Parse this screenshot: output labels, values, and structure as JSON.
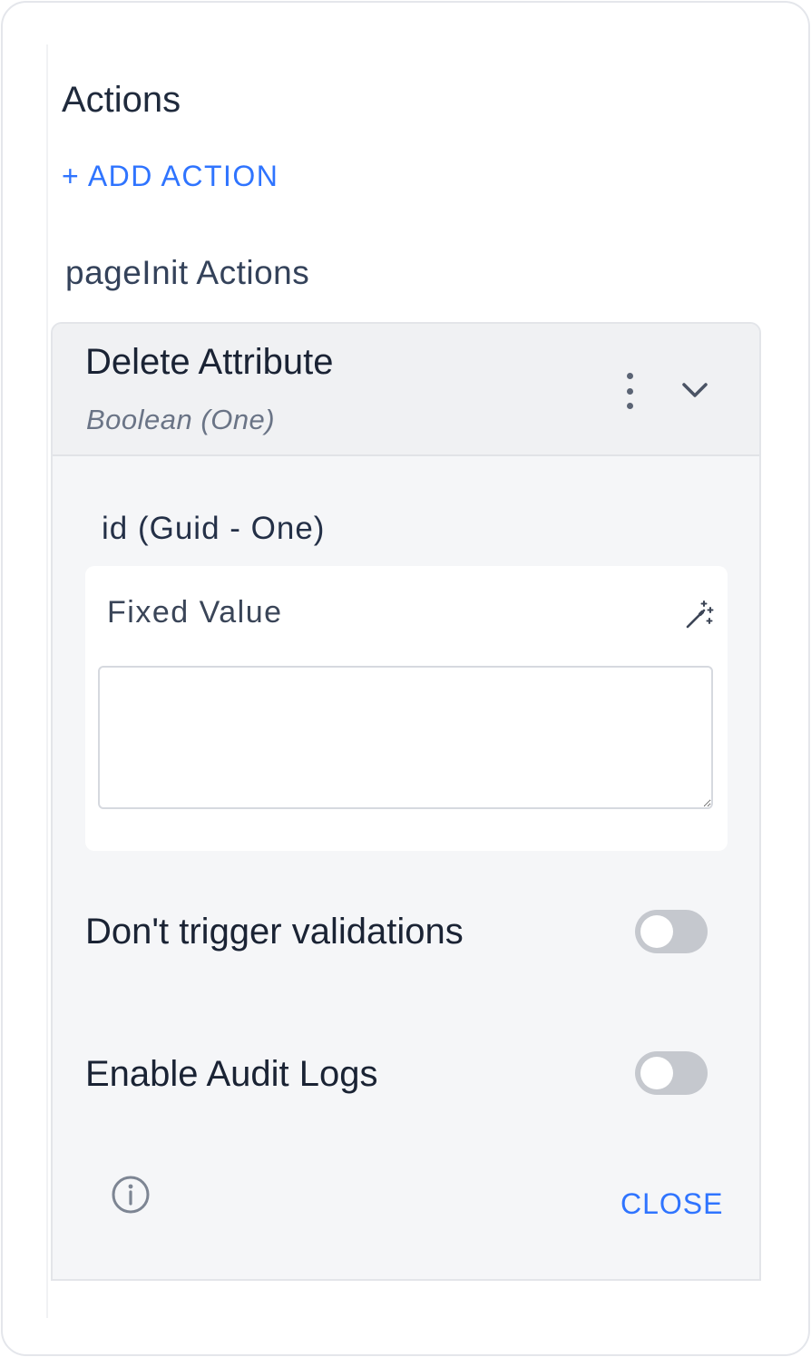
{
  "panel": {
    "title": "Actions",
    "add_action_label": "+ ADD ACTION",
    "group_title": "pageInit Actions"
  },
  "action": {
    "name": "Delete Attribute",
    "type": "Boolean (One)",
    "menu_icon": "kebab-menu-icon",
    "expand_icon": "chevron-down-icon",
    "parameter": {
      "label": "id (Guid - One)",
      "mode_label": "Fixed Value",
      "mode_icon": "magic-wand-icon",
      "value": "",
      "placeholder": ""
    },
    "toggles": [
      {
        "label": "Don't trigger validations",
        "on": false
      },
      {
        "label": "Enable Audit Logs",
        "on": false
      }
    ],
    "info_icon": "info-icon",
    "close_label": "CLOSE"
  },
  "colors": {
    "accent": "#2f74ff",
    "text_dark": "#1a2334",
    "card_bg": "#f5f6f8",
    "toggle_off": "#c5c8ce"
  }
}
